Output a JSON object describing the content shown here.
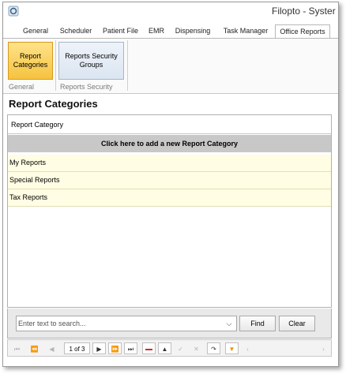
{
  "window": {
    "title": "Filopto - Syster"
  },
  "tabs": [
    {
      "label": "General"
    },
    {
      "label": "Scheduler"
    },
    {
      "label": "Patient File"
    },
    {
      "label": "EMR"
    },
    {
      "label": "Dispensing"
    },
    {
      "label": "Task Manager"
    },
    {
      "label": "Office Reports"
    }
  ],
  "active_tab": "Office Reports",
  "ribbon": {
    "buttons": [
      {
        "label": "Report\nCategories",
        "group": "General",
        "active": true
      },
      {
        "label": "Reports Security\nGroups",
        "group": "Reports Security",
        "active": false
      }
    ],
    "groups": [
      "General",
      "Reports Security"
    ]
  },
  "section": {
    "title": "Report Categories"
  },
  "grid": {
    "column_header": "Report Category",
    "add_row_label": "Click here to add a new Report Category",
    "rows": [
      "My Reports",
      "Special Reports",
      "Tax Reports"
    ]
  },
  "search": {
    "placeholder": "Enter text to search...",
    "find_label": "Find",
    "clear_label": "Clear"
  },
  "navigator": {
    "page_info": "1 of 3"
  },
  "colors": {
    "active_button": "#f5c33f",
    "row_background": "#fffde3",
    "add_row_background": "#c8c8c8",
    "delete_icon": "#d9262b",
    "filter_icon": "#f08c00"
  }
}
